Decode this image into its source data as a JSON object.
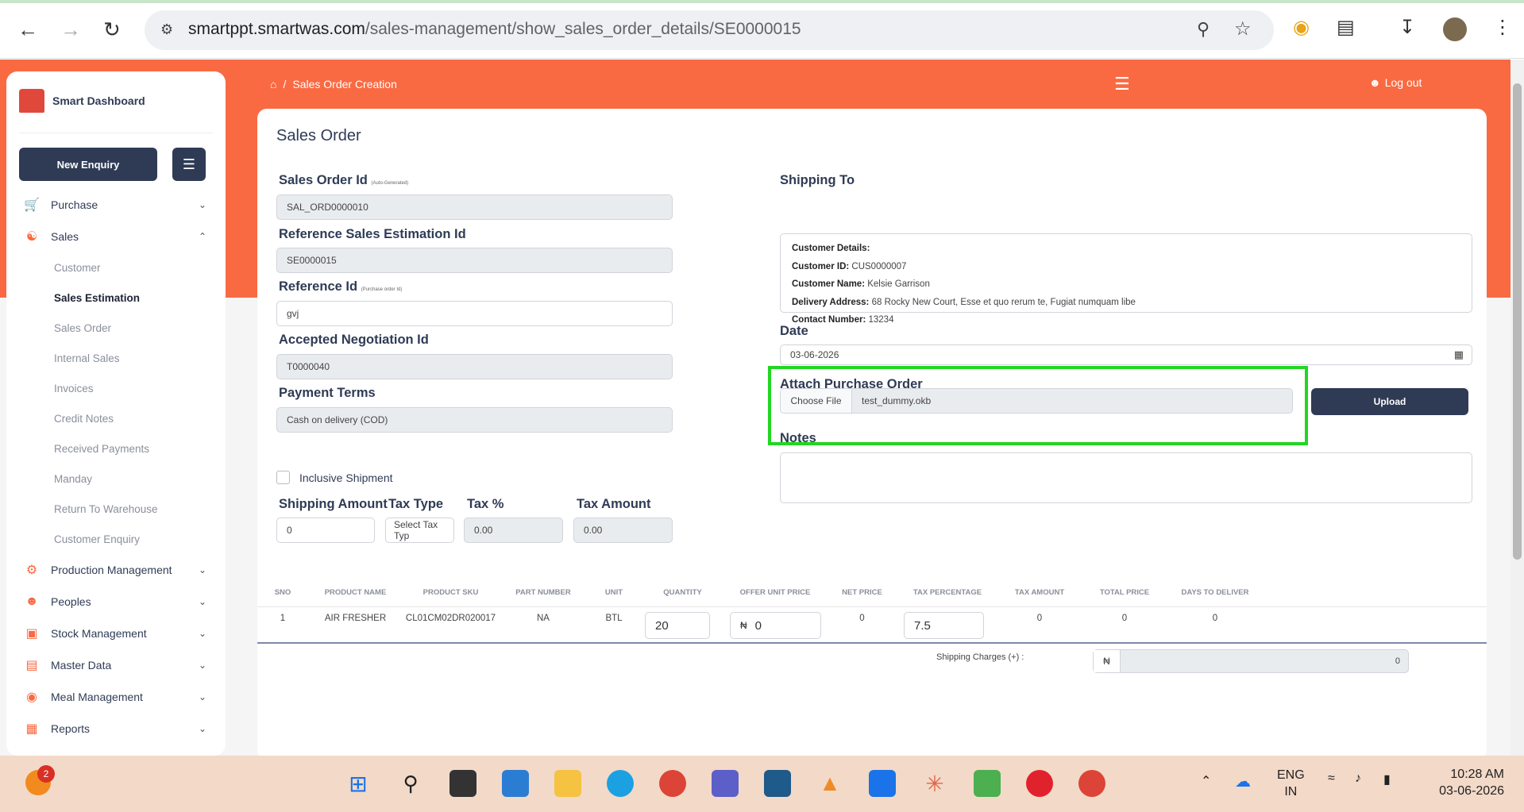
{
  "browser": {
    "url_host": "smartppt.smartwas.com",
    "url_path": "/sales-management/show_sales_order_details/SE0000015"
  },
  "sidebar": {
    "brand": "Smart Dashboard",
    "new_enquiry": "New Enquiry",
    "menu": [
      {
        "label": "Purchase",
        "icon": "cart-icon"
      },
      {
        "label": "Sales",
        "icon": "sales-icon"
      }
    ],
    "sales_sub": [
      "Customer",
      "Sales Estimation",
      "Sales Order",
      "Internal Sales",
      "Invoices",
      "Credit Notes",
      "Received Payments",
      "Manday",
      "Return To Warehouse",
      "Customer Enquiry"
    ],
    "menu_bottom": [
      "Production Management",
      "Peoples",
      "Stock Management",
      "Master Data",
      "Meal Management",
      "Reports"
    ]
  },
  "header": {
    "breadcrumb": "Sales Order Creation",
    "logout": "Log out"
  },
  "form": {
    "title": "Sales Order",
    "sales_order_id_label": "Sales Order Id",
    "sales_order_id_hint": "(Auto-Generated)",
    "sales_order_id": "SAL_ORD0000010",
    "ref_estimation_label": "Reference Sales Estimation Id",
    "ref_estimation": "SE0000015",
    "reference_id_label": "Reference Id",
    "reference_id_hint": "(Purchase order Id)",
    "reference_id": "gvj",
    "negotiation_label": "Accepted Negotiation Id",
    "negotiation": "T0000040",
    "payment_terms_label": "Payment Terms",
    "payment_terms": "Cash on delivery (COD)",
    "inclusive_shipment": "Inclusive Shipment",
    "shipping_amount_label": "Shipping Amount",
    "shipping_amount": "0",
    "tax_type_label": "Tax Type",
    "tax_type": "Select Tax Typ",
    "tax_pct_label": "Tax %",
    "tax_pct": "0.00",
    "tax_amount_label": "Tax Amount",
    "tax_amount": "0.00",
    "shipping_to_label": "Shipping To",
    "customer_details": "Customer Details:",
    "customer_id_k": "Customer ID:",
    "customer_id": "CUS0000007",
    "customer_name_k": "Customer Name:",
    "customer_name": "Kelsie Garrison",
    "delivery_address_k": "Delivery Address:",
    "delivery_address": "68 Rocky New Court, Esse et quo rerum te, Fugiat numquam libe",
    "contact_k": "Contact Number:",
    "contact": "13234",
    "date_label": "Date",
    "date": "03-06-2026",
    "attach_label": "Attach Purchase Order",
    "choose_file": "Choose File",
    "file_name": "test_dummy.okb",
    "upload": "Upload",
    "notes_label": "Notes"
  },
  "table": {
    "columns": [
      "SNO",
      "PRODUCT NAME",
      "PRODUCT SKU",
      "PART NUMBER",
      "UNIT",
      "QUANTITY",
      "OFFER UNIT PRICE",
      "NET PRICE",
      "TAX PERCENTAGE",
      "TAX AMOUNT",
      "TOTAL PRICE",
      "DAYS TO DELIVER"
    ],
    "row": {
      "sno": "1",
      "name": "AIR FRESHER",
      "sku": "CL01CM02DR020017",
      "part": "NA",
      "unit": "BTL",
      "qty": "20",
      "currency": "₦",
      "price": "0",
      "net": "0",
      "tax_pct": "7.5",
      "tax_amt": "0",
      "total": "0",
      "days": "0"
    },
    "shipping_charges_label": "Shipping Charges (+) :",
    "shipping_charges": "0"
  },
  "taskbar": {
    "badge": "2",
    "lang1": "ENG",
    "lang2": "IN",
    "time": "10:28 AM",
    "date": "03-06-2026"
  }
}
